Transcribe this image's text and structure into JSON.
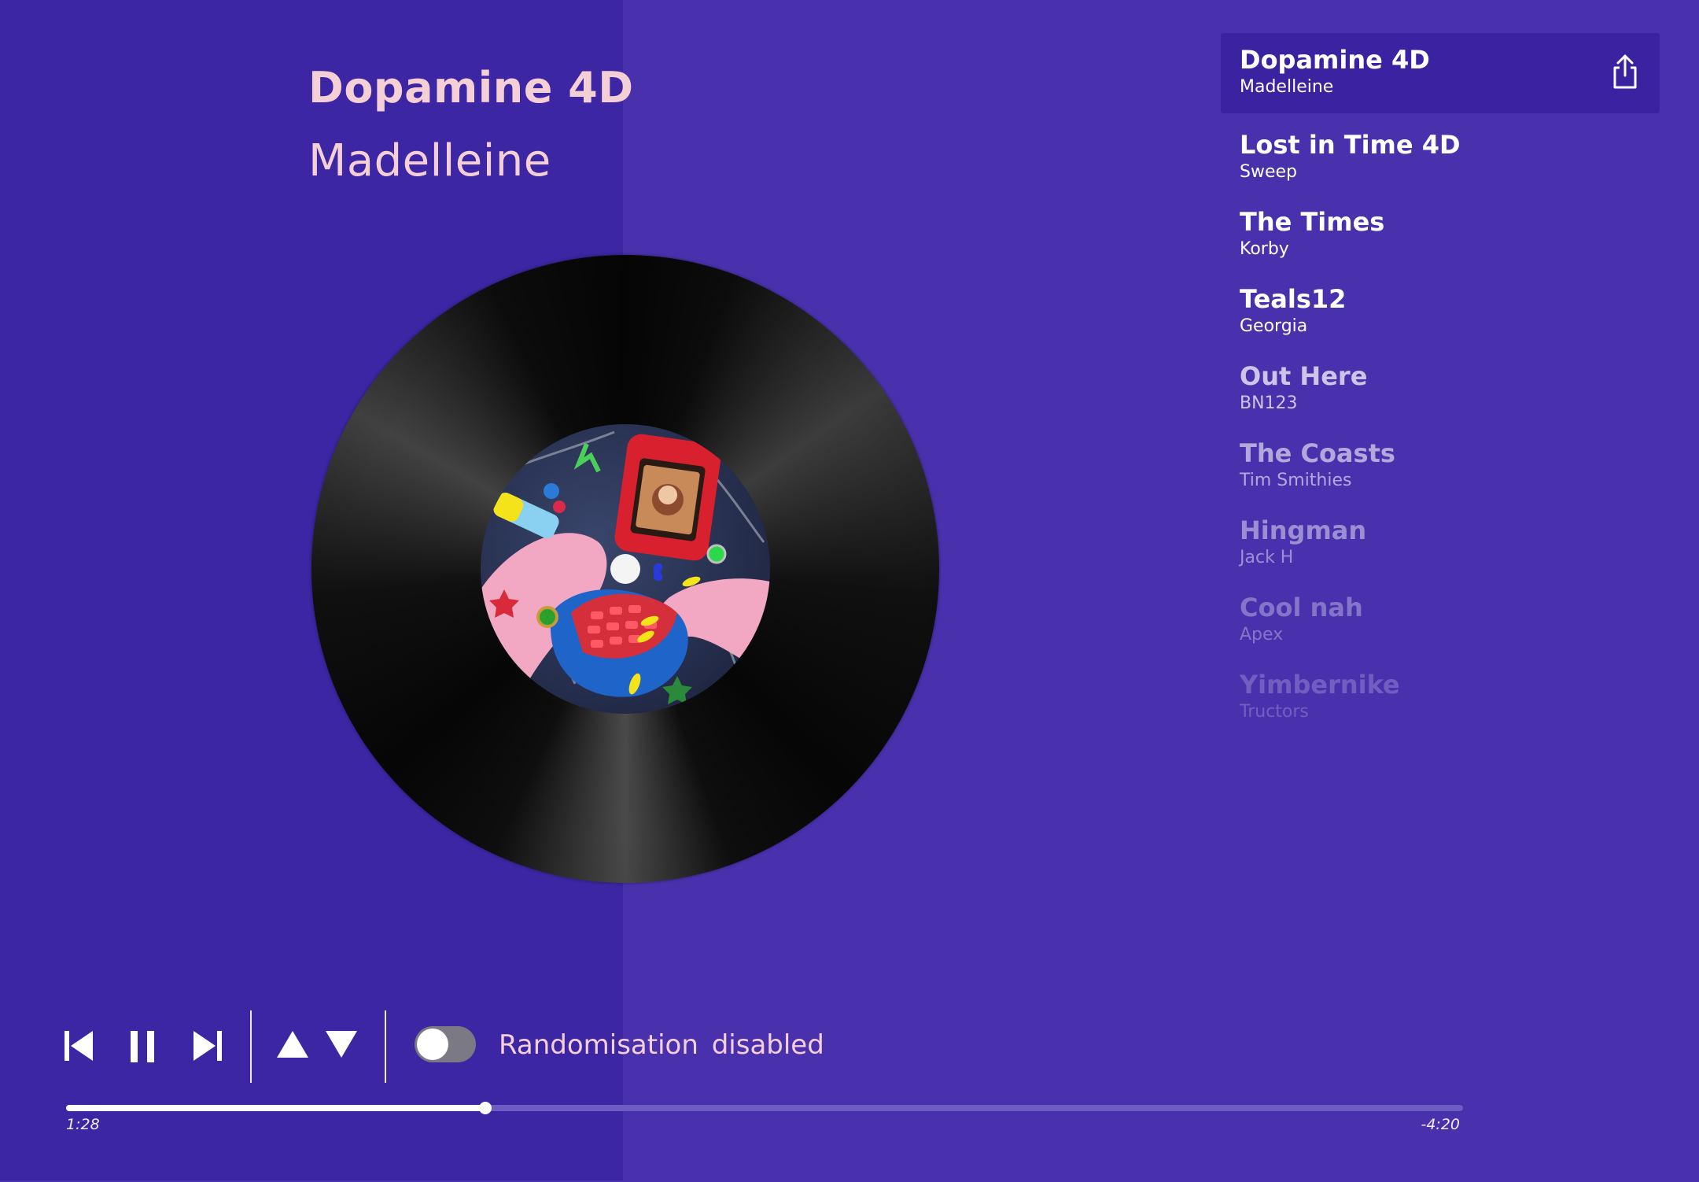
{
  "now_playing": {
    "title": "Dopamine 4D",
    "artist": "Madelleine"
  },
  "playlist": [
    {
      "title": "Dopamine 4D",
      "artist": "Madelleine",
      "active": true,
      "opacity": 1.0
    },
    {
      "title": "Lost in Time 4D",
      "artist": "Sweep",
      "active": false,
      "opacity": 1.0
    },
    {
      "title": "The Times",
      "artist": "Korby",
      "active": false,
      "opacity": 1.0
    },
    {
      "title": "Teals12",
      "artist": "Georgia",
      "active": false,
      "opacity": 1.0
    },
    {
      "title": "Out Here",
      "artist": "BN123",
      "active": false,
      "opacity": 0.72
    },
    {
      "title": "The Coasts",
      "artist": "Tim Smithies",
      "active": false,
      "opacity": 0.58
    },
    {
      "title": "Hingman",
      "artist": "Jack H",
      "active": false,
      "opacity": 0.45
    },
    {
      "title": "Cool nah",
      "artist": "Apex",
      "active": false,
      "opacity": 0.33
    },
    {
      "title": "Yimbernike",
      "artist": "Tructors",
      "active": false,
      "opacity": 0.22
    }
  ],
  "controls": {
    "previous_icon": "skip-previous-icon",
    "pause_icon": "pause-icon",
    "next_icon": "skip-next-icon",
    "move_up_icon": "triangle-up-icon",
    "move_down_icon": "triangle-down-icon",
    "share_icon": "share-icon",
    "randomisation_label": "Randomisation disabled",
    "randomisation_enabled": false
  },
  "progress": {
    "elapsed": "1:28",
    "remaining": "-4:20",
    "fraction": 0.3
  },
  "colors": {
    "left_background": "#3c26a3",
    "right_background": "#4931ad",
    "active_track_background": "#3a22a0",
    "accent_text": "#f4cfd6",
    "progress_track": "#6d5cc4",
    "progress_fill": "#ffffff",
    "toggle_off": "#7a7984"
  }
}
